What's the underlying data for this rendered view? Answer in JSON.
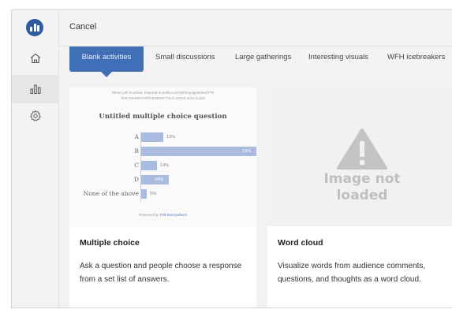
{
  "header": {
    "cancel_label": "Cancel"
  },
  "rail": {
    "items": [
      "home-icon",
      "chart-icon",
      "gear-icon"
    ],
    "accent": "#2f5c9e"
  },
  "tabs": [
    "Blank activities",
    "Small discussions",
    "Large gatherings",
    "Interesting visuals",
    "WFH icebreakers"
  ],
  "cards": [
    {
      "preview": {
        "instructions": [
          "When poll is active, respond at pollev.com/johnnyappleseed779",
          "Text JOHNNYAPPLESEED779 to 22333 once to join"
        ],
        "question": "Untitled multiple choice question",
        "options": [
          {
            "label": "A",
            "percent": 19,
            "text": "19%"
          },
          {
            "label": "B",
            "percent": 100,
            "text": "19%"
          },
          {
            "label": "C",
            "percent": 14,
            "text": "14%"
          },
          {
            "label": "D",
            "percent": 24,
            "text": "24%"
          },
          {
            "label": "None of the above",
            "percent": 5,
            "text": "5%"
          }
        ],
        "powered_by": "Powered by",
        "brand": "Poll Everywhere"
      },
      "title": "Multiple choice",
      "description": "Ask a question and people choose a response from a set list of answers."
    },
    {
      "preview": {
        "missing_text_1": "Image not",
        "missing_text_2": "loaded"
      },
      "title": "Word cloud",
      "description": "Visualize words from audience comments, questions, and thoughts as a word cloud."
    }
  ],
  "colors": {
    "tab_active": "#3f6fb6",
    "bar": "#a9bce0"
  }
}
